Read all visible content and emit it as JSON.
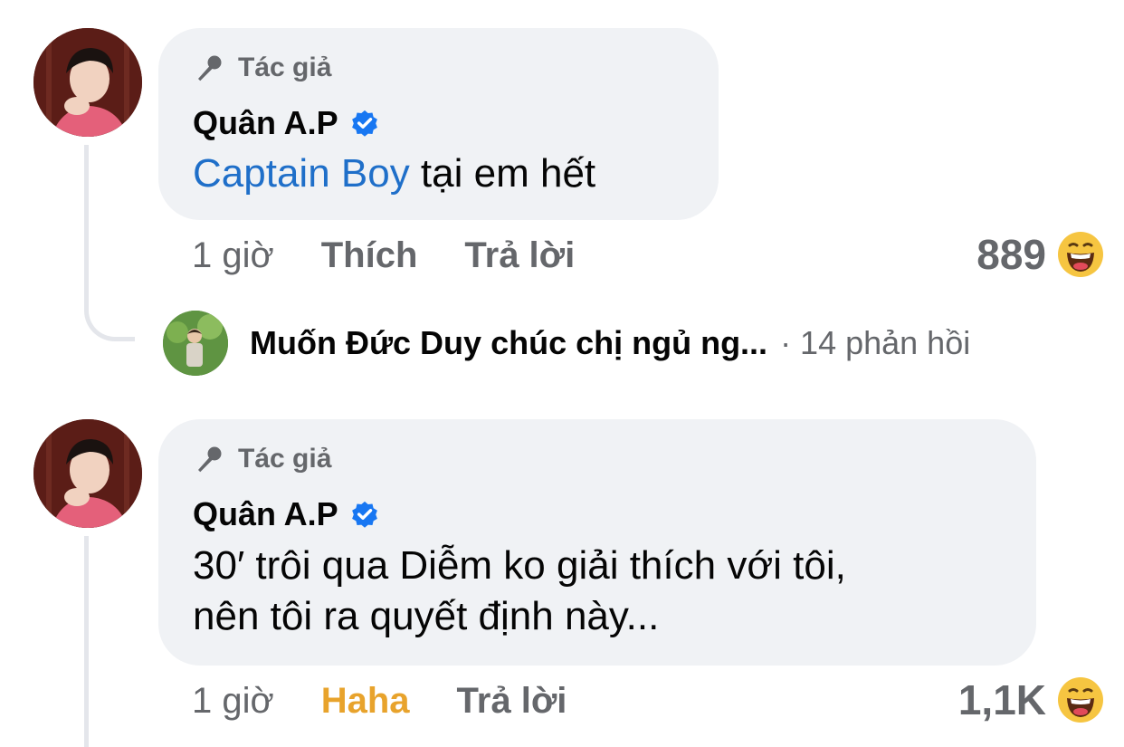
{
  "comments": [
    {
      "badge": "Tác giả",
      "author": "Quân A.P",
      "mention": "Captain Boy",
      "text_after_mention": " tại em hết",
      "time": "1 giờ",
      "like_label": "Thích",
      "reply_label": "Trả lời",
      "reaction_count": "889",
      "reaction_icon": "haha-emoji-icon"
    },
    {
      "badge": "Tác giả",
      "author": "Quân A.P",
      "text_line1": "30′ trôi qua Diễm ko giải thích với tôi,",
      "text_line2": "nên tôi ra quyết định này...",
      "time": "1 giờ",
      "like_label": "Haha",
      "reply_label": "Trả lời",
      "reaction_count": "1,1K",
      "reaction_icon": "haha-emoji-icon"
    }
  ],
  "reply_preview": {
    "text": "Muốn Đức Duy chúc chị ngủ ng...",
    "count": "· 14 phản hồi"
  },
  "colors": {
    "bubble": "#f0f2f5",
    "mention": "#1f6fc9",
    "verified": "#1877f2",
    "haha": "#e8a32c",
    "muted": "#65676b"
  }
}
